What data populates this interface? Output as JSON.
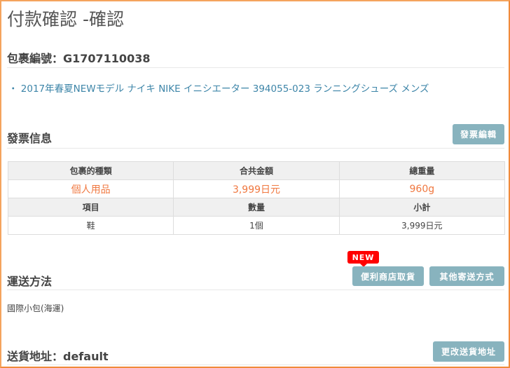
{
  "page_title": "付款確認 -確認",
  "package": {
    "label": "包裹編號：G1707110038",
    "product": "・ 2017年春夏NEWモデル ナイキ NIKE イニシエーター 394055-023 ランニングシューズ メンズ"
  },
  "invoice": {
    "heading": "發票信息",
    "edit_button": "發票編輯",
    "table": {
      "header1": [
        "包裹的種類",
        "合共金額",
        "總重量"
      ],
      "values1": [
        "個人用品",
        "3,999日元",
        "960g"
      ],
      "header2": [
        "項目",
        "數量",
        "小計"
      ],
      "values2": [
        "鞋",
        "1個",
        "3,999日元"
      ]
    }
  },
  "shipping": {
    "heading": "運送方法",
    "new_badge": "NEW",
    "convenience_button": "便利商店取貨",
    "other_button": "其他寄送方式",
    "method": "國際小包(海運)"
  },
  "address": {
    "heading": "送貨地址：default",
    "change_button": "更改送貨地址"
  }
}
